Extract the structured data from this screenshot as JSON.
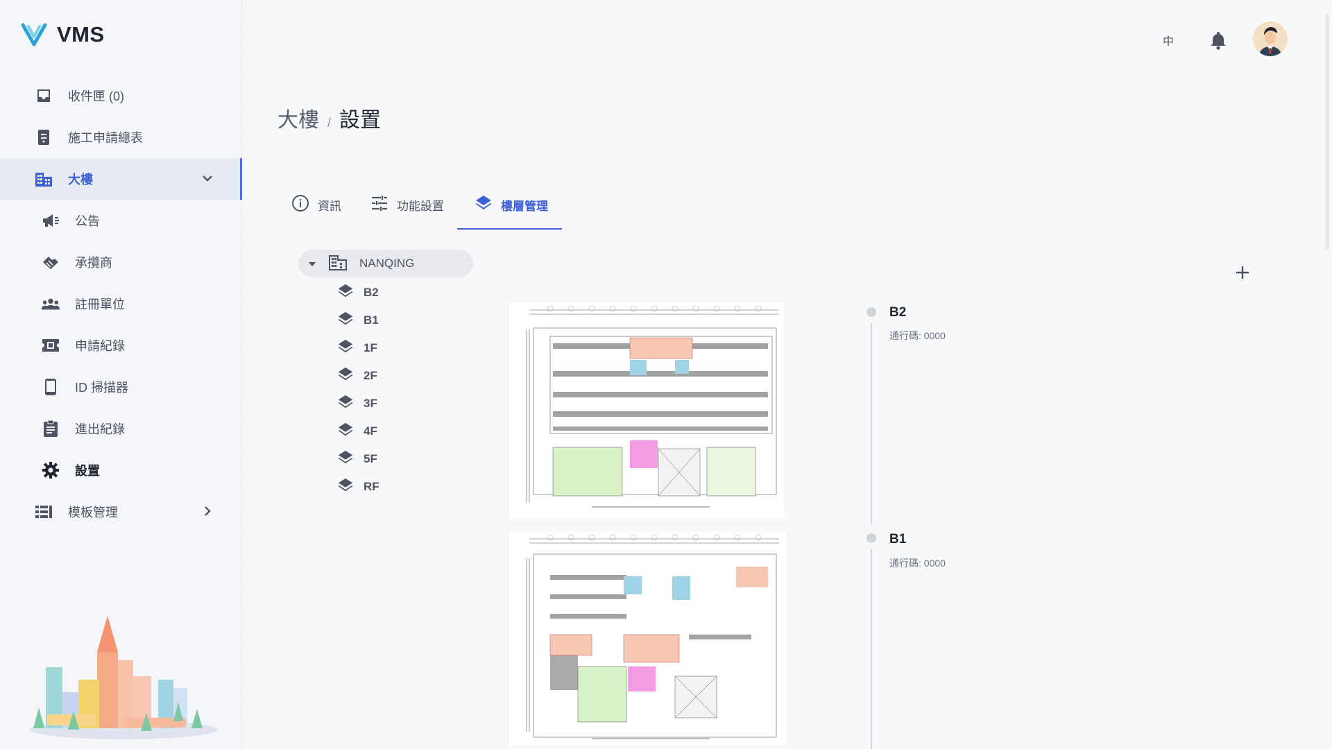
{
  "app": {
    "name": "VMS"
  },
  "sidebar": {
    "items": [
      {
        "label": "收件匣 (0)",
        "icon": "inbox-icon"
      },
      {
        "label": "施工申請總表",
        "icon": "document-icon"
      },
      {
        "label": "大樓",
        "icon": "building-icon",
        "active": true,
        "expanded": true
      },
      {
        "label": "公告",
        "icon": "megaphone-icon"
      },
      {
        "label": "承攬商",
        "icon": "handshake-icon"
      },
      {
        "label": "註冊單位",
        "icon": "group-icon"
      },
      {
        "label": "申請紀錄",
        "icon": "ticket-icon"
      },
      {
        "label": "ID 掃描器",
        "icon": "phone-icon"
      },
      {
        "label": "進出紀錄",
        "icon": "clipboard-icon"
      },
      {
        "label": "設置",
        "icon": "gear-icon"
      },
      {
        "label": "模板管理",
        "icon": "template-icon"
      }
    ]
  },
  "header": {
    "lang": "中",
    "notification_icon": "bell-icon",
    "avatar": "user-avatar"
  },
  "breadcrumb": {
    "parent": "大樓",
    "separator": "/",
    "current": "設置"
  },
  "tabs": [
    {
      "label": "資訊",
      "icon": "info-icon"
    },
    {
      "label": "功能設置",
      "icon": "sliders-icon"
    },
    {
      "label": "樓層管理",
      "icon": "layers-icon",
      "active": true
    }
  ],
  "tree": {
    "root": "NANQING",
    "floors": [
      "B2",
      "B1",
      "1F",
      "2F",
      "3F",
      "4F",
      "5F",
      "RF"
    ]
  },
  "floors_list": [
    {
      "name": "B2",
      "code": "通行碼: 0000"
    },
    {
      "name": "B1",
      "code": "通行碼: 0000"
    }
  ],
  "colors": {
    "accent": "#3f5fd6",
    "active_bg": "#e7eaf3",
    "logo": "#2ba3d6"
  }
}
